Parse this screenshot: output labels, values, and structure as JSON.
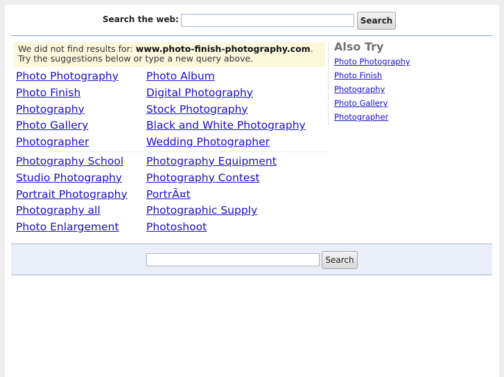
{
  "top_search": {
    "label": "Search the web:",
    "input_value": "",
    "button_label": "Search"
  },
  "notice": {
    "prefix": "We did not find results for: ",
    "query": "www.photo-finish-photography.com",
    "suffix": ".",
    "line2": "Try the suggestions below or type a new query above."
  },
  "related": {
    "group1": {
      "col1": [
        "Photo Photography",
        "Photo Finish",
        "Photography",
        "Photo Gallery",
        "Photographer"
      ],
      "col2": [
        "Photo Album",
        "Digital Photography",
        "Stock Photography",
        "Black and White Photography",
        "Wedding Photographer"
      ]
    },
    "group2": {
      "col1": [
        "Photography School",
        "Studio Photography",
        "Portrait Photography",
        "Photography all",
        "Photo Enlargement"
      ],
      "col2": [
        "Photography Equipment",
        "Photography Contest",
        "PortrÃ¤t",
        "Photographic Supply",
        "Photoshoot"
      ]
    }
  },
  "also_try": {
    "title": "Also Try",
    "links": [
      "Photo Photography",
      "Photo Finish",
      "Photography",
      "Photo Gallery",
      "Photographer"
    ]
  },
  "bottom_search": {
    "input_value": "",
    "button_label": "Search"
  },
  "colors": {
    "link": "#1a0dcc",
    "notice_bg": "#fbf8dc",
    "bar_bg": "#e9eef9",
    "rule": "#8aa3c0"
  }
}
